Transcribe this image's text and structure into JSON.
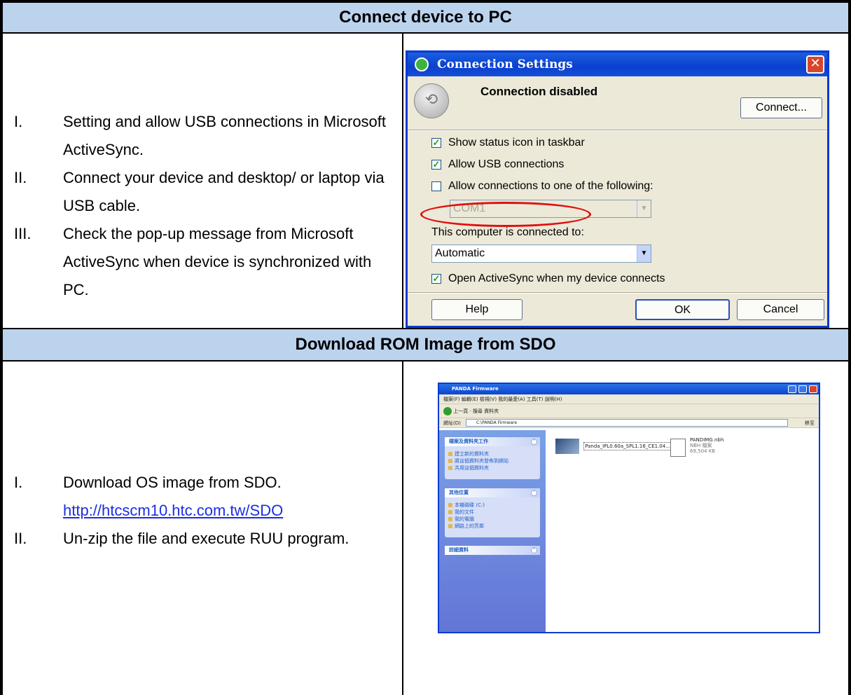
{
  "sections": [
    {
      "heading": "Connect device to PC",
      "steps": [
        {
          "num": "I.",
          "text": "Setting and allow USB connections in Microsoft ActiveSync."
        },
        {
          "num": "II.",
          "text": "Connect your device and desktop/ or laptop via USB cable."
        },
        {
          "num": "III.",
          "text": "Check the pop-up message from Microsoft ActiveSync when device is synchronized with PC."
        }
      ]
    },
    {
      "heading": "Download ROM Image from SDO",
      "steps": [
        {
          "num": "I.",
          "text": "Download OS image from SDO.",
          "link": "http://htcscm10.htc.com.tw/SDO"
        },
        {
          "num": "II.",
          "text": "Un-zip the file and execute RUU program."
        }
      ]
    }
  ],
  "dialog": {
    "title": "Connection Settings",
    "close_glyph": "✕",
    "status": "Connection disabled",
    "connect_button": "Connect...",
    "show_status_icon": {
      "label": "Show status icon in taskbar",
      "checked": true
    },
    "allow_usb": {
      "label": "Allow USB connections",
      "checked": true
    },
    "allow_connections": {
      "label": "Allow connections to one of the following:",
      "checked": false
    },
    "port": "COM1",
    "connected_to_label": "This computer is connected to:",
    "connected_to_value": "Automatic",
    "open_activesync": {
      "label": "Open ActiveSync when my device connects",
      "checked": true
    },
    "help_button": "Help",
    "ok_button": "OK",
    "cancel_button": "Cancel",
    "check_glyph": "✓"
  },
  "explorer": {
    "title": "PANDA Firmware",
    "menu": "檔案(F)  編輯(E)  檢視(V)  我的最愛(A)  工具(T)  說明(H)",
    "toolbar": "上一頁  ·  搜尋  資料夾",
    "address_label": "網址(D)",
    "address": "C:\\PANDA Firmware",
    "go_label": "移至",
    "groups": [
      {
        "heading": "檔案及資料夾工作",
        "items": [
          "建立新的資料夾",
          "將這個資料夾發佈到網站",
          "共用這個資料夾"
        ]
      },
      {
        "heading": "其他位置",
        "items": [
          "本機磁碟 (C:)",
          "我的文件",
          "我的電腦",
          "網路上的芳鄰"
        ]
      },
      {
        "heading": "詳細資料",
        "items": []
      }
    ],
    "files": [
      {
        "name": "Panda_IPL0.60a_SPL1.16_CE1.04..."
      },
      {
        "name": "PANDIMG.nbh",
        "type": "NBH 檔案",
        "size": "69,504 KB"
      }
    ]
  }
}
